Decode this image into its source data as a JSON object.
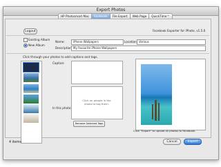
{
  "window": {
    "title": "Export Photos"
  },
  "tabs": [
    {
      "label": "HP Photosmart Mac",
      "active": false
    },
    {
      "label": "Facebook",
      "active": true
    },
    {
      "label": "File Export",
      "active": false
    },
    {
      "label": "Web Page",
      "active": false
    },
    {
      "label": "QuickTime™",
      "active": false
    }
  ],
  "header": {
    "logout_label": "Logout",
    "exporter_version": "Facebook Exporter for iPhoto, v1.5.0"
  },
  "album": {
    "existing_label": "Existing Album",
    "new_label": "New Album",
    "selected": "new",
    "name_label": "Name:",
    "name_value": "iPhone Wallpapers",
    "location_label": "Location:",
    "location_value": "Various",
    "description_label": "Description:",
    "description_value": "My favourite iPhone Wallpapers"
  },
  "photos": {
    "instruction": "Click through your photos to add captions and tags.",
    "caption_label": "Caption:",
    "in_photo_label": "In this photo:",
    "tag_hint": "Click on people in the photo to tag them.",
    "remove_tags_label": "Remove Selected Tags"
  },
  "footer": {
    "upload_hint": "Click \"Export\" to upload all photos to Facebook.",
    "item_count": "4 items",
    "cancel_label": "Cancel",
    "export_label": "Export"
  },
  "colors": {
    "accent": "#3d83dc",
    "selected_tab": "#6d9fd6"
  }
}
